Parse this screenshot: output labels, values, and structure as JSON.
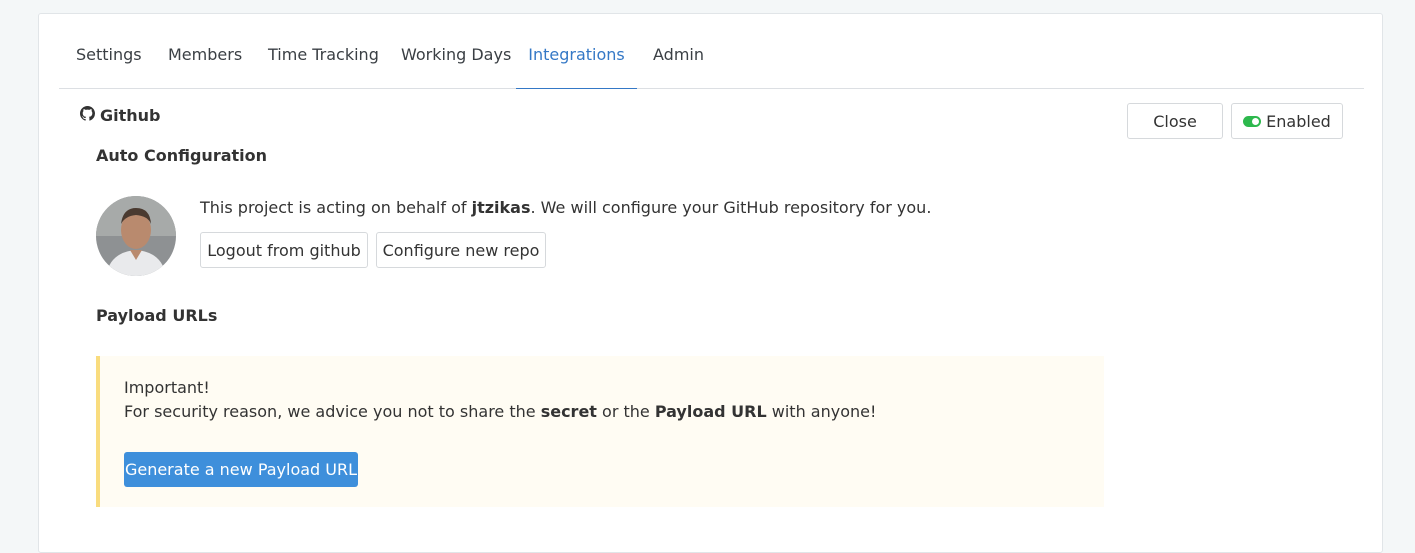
{
  "tabs": [
    {
      "label": "Settings",
      "active": false
    },
    {
      "label": "Members",
      "active": false
    },
    {
      "label": "Time Tracking",
      "active": false
    },
    {
      "label": "Working Days",
      "active": false
    },
    {
      "label": "Integrations",
      "active": true
    },
    {
      "label": "Admin",
      "active": false
    }
  ],
  "integration": {
    "title": "Github",
    "close_label": "Close",
    "enabled_label": "Enabled",
    "enabled": true
  },
  "auto_config": {
    "title": "Auto Configuration",
    "text_before": "This project is acting on behalf of ",
    "username": "jtzikas",
    "text_after": ". We will configure your GitHub repository for you.",
    "logout_label": "Logout from github",
    "configure_label": "Configure new repo"
  },
  "payload": {
    "title": "Payload URLs",
    "important": "Important!",
    "warning_before": "For security reason, we advice you not to share the ",
    "secret": "secret",
    "warning_mid": " or the ",
    "payload_url": "Payload URL",
    "warning_after": " with anyone!",
    "generate_label": "Generate a new Payload URL"
  },
  "colors": {
    "accent": "#3478c6",
    "primary_button": "#3e8fdb",
    "toggle_on": "#2db84d",
    "alert_border": "#f9dc7e",
    "alert_bg": "#fffcf3"
  }
}
